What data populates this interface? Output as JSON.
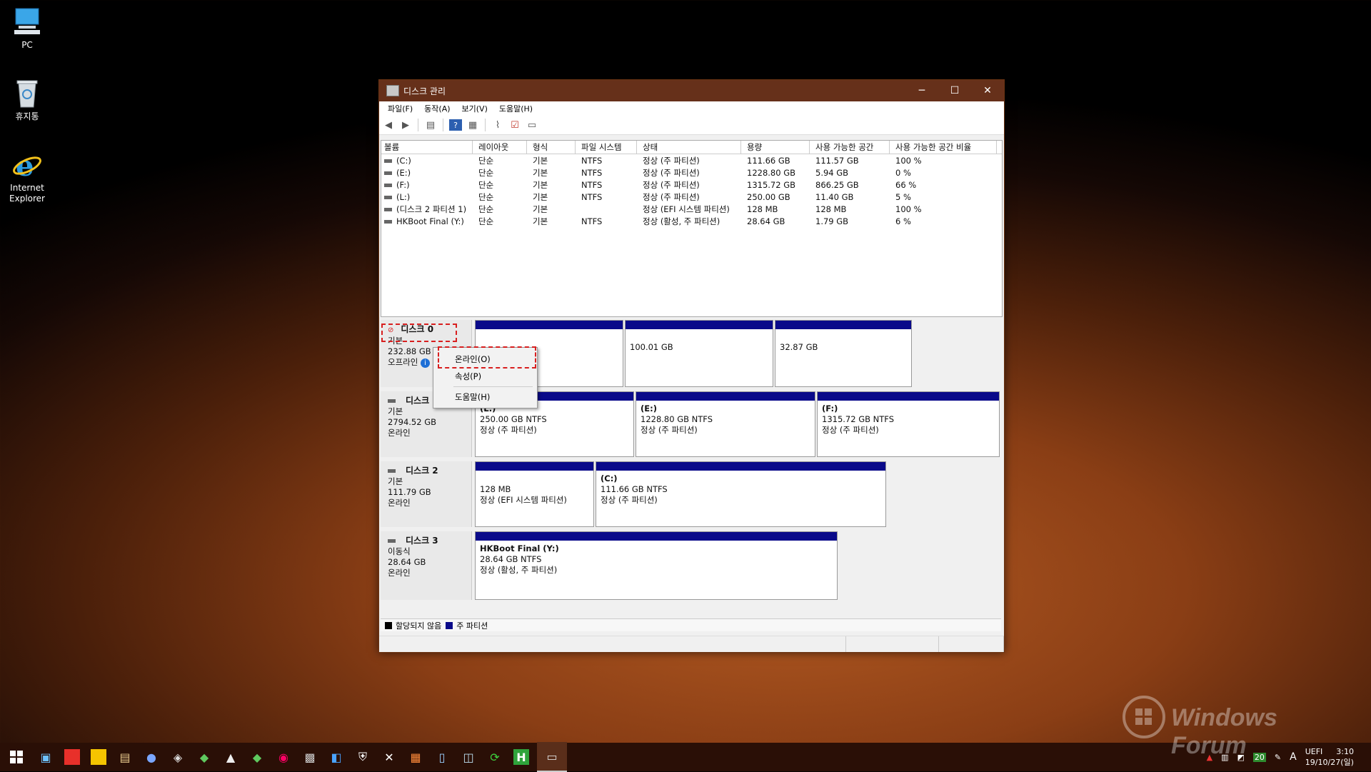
{
  "desktop": {
    "icons": [
      {
        "label_l1": "PC",
        "label_l2": "",
        "icon": "pc-icon"
      },
      {
        "label_l1": "휴지통",
        "label_l2": "",
        "icon": "recycle-bin-icon"
      },
      {
        "label_l1": "Internet",
        "label_l2": "Explorer",
        "icon": "internet-explorer-icon"
      }
    ]
  },
  "window": {
    "title": "디스크 관리",
    "menu": [
      "파일(F)",
      "동작(A)",
      "보기(V)",
      "도움말(H)"
    ],
    "columns": [
      "볼륨",
      "레이아웃",
      "형식",
      "파일 시스템",
      "상태",
      "용량",
      "사용 가능한 공간",
      "사용 가능한 공간 비율"
    ],
    "volumes": [
      [
        "(C:)",
        "단순",
        "기본",
        "NTFS",
        "정상 (주 파티션)",
        "111.66 GB",
        "111.57 GB",
        "100 %"
      ],
      [
        "(E:)",
        "단순",
        "기본",
        "NTFS",
        "정상 (주 파티션)",
        "1228.80 GB",
        "5.94 GB",
        "0 %"
      ],
      [
        "(F:)",
        "단순",
        "기본",
        "NTFS",
        "정상 (주 파티션)",
        "1315.72 GB",
        "866.25 GB",
        "66 %"
      ],
      [
        "(L:)",
        "단순",
        "기본",
        "NTFS",
        "정상 (주 파티션)",
        "250.00 GB",
        "11.40 GB",
        "5 %"
      ],
      [
        "(디스크 2 파티션 1)",
        "단순",
        "기본",
        "",
        "정상 (EFI 시스템 파티션)",
        "128 MB",
        "128 MB",
        "100 %"
      ],
      [
        "HKBoot Final (Y:)",
        "단순",
        "기본",
        "NTFS",
        "정상 (활성, 주 파티션)",
        "28.64 GB",
        "1.79 GB",
        "6 %"
      ]
    ],
    "disks": [
      {
        "name": "디스크 0",
        "type": "기본",
        "size": "232.88 GB",
        "status": "오프라인",
        "partitions": [
          {
            "name": "",
            "size": "",
            "state": ""
          },
          {
            "name": "",
            "size": "100.01 GB",
            "state": ""
          },
          {
            "name": "",
            "size": "32.87 GB",
            "state": ""
          }
        ]
      },
      {
        "name": "디스크 1",
        "type": "기본",
        "size": "2794.52 GB",
        "status": "온라인",
        "partitions": [
          {
            "name": "(L:)",
            "size": "250.00 GB NTFS",
            "state": "정상 (주 파티션)"
          },
          {
            "name": "(E:)",
            "size": "1228.80 GB NTFS",
            "state": "정상 (주 파티션)"
          },
          {
            "name": "(F:)",
            "size": "1315.72 GB NTFS",
            "state": "정상 (주 파티션)"
          }
        ]
      },
      {
        "name": "디스크 2",
        "type": "기본",
        "size": "111.79 GB",
        "status": "온라인",
        "partitions": [
          {
            "name": "",
            "size": "128 MB",
            "state": "정상 (EFI 시스템 파티션)"
          },
          {
            "name": "(C:)",
            "size": "111.66 GB NTFS",
            "state": "정상 (주 파티션)"
          }
        ]
      },
      {
        "name": "디스크 3",
        "type": "이동식",
        "size": "28.64 GB",
        "status": "온라인",
        "partitions": [
          {
            "name": "HKBoot Final  (Y:)",
            "size": "28.64 GB NTFS",
            "state": "정상 (활성, 주 파티션)"
          }
        ]
      }
    ],
    "context_menu": [
      "온라인(O)",
      "속성(P)",
      "도움말(H)"
    ],
    "legend": [
      "할당되지 않음",
      "주 파티션"
    ],
    "colors": {
      "primary_partition": "#0a0a8a",
      "unallocated": "#000000",
      "highlight": "#d81f1f"
    }
  },
  "taskbar": {
    "tray": {
      "time": "3:10",
      "date": "19/10/27(일)",
      "label": "UEFI",
      "badge": "20",
      "ime": "A"
    }
  },
  "watermark": "Windows Forum"
}
